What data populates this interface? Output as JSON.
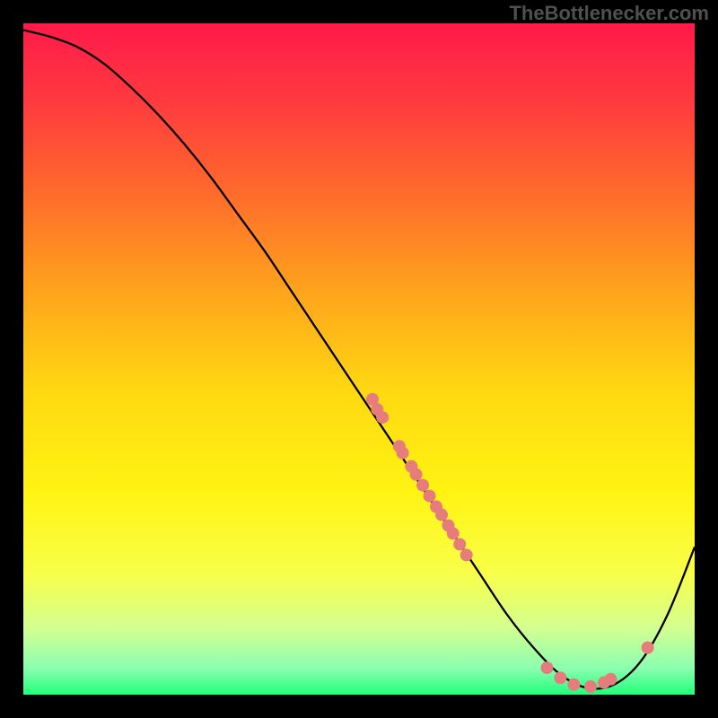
{
  "watermark": "TheBottlenecker.com",
  "chart_data": {
    "type": "line",
    "title": "",
    "xlabel": "",
    "ylabel": "",
    "xlim": [
      0,
      100
    ],
    "ylim": [
      0,
      100
    ],
    "background_gradient": {
      "stops": [
        {
          "offset": 0.0,
          "color": "#ff1a4a"
        },
        {
          "offset": 0.12,
          "color": "#ff3b3e"
        },
        {
          "offset": 0.25,
          "color": "#ff6a2c"
        },
        {
          "offset": 0.4,
          "color": "#ffa41c"
        },
        {
          "offset": 0.55,
          "color": "#ffd911"
        },
        {
          "offset": 0.7,
          "color": "#fff413"
        },
        {
          "offset": 0.82,
          "color": "#f8ff4a"
        },
        {
          "offset": 0.9,
          "color": "#d4ff90"
        },
        {
          "offset": 0.96,
          "color": "#8cffb0"
        },
        {
          "offset": 1.0,
          "color": "#20ff7a"
        }
      ]
    },
    "series": [
      {
        "name": "bottleneck-curve",
        "x": [
          0,
          4,
          8,
          12,
          16,
          20,
          24,
          28,
          32,
          36,
          40,
          44,
          48,
          52,
          56,
          60,
          64,
          68,
          72,
          76,
          80,
          84,
          88,
          92,
          96,
          100
        ],
        "y": [
          99,
          98,
          96.5,
          94,
          90.5,
          86.5,
          82,
          77,
          71.5,
          66,
          60,
          54,
          48,
          42,
          36,
          30,
          24,
          18,
          12,
          7,
          3,
          1,
          1.5,
          5,
          12,
          22
        ]
      }
    ],
    "scatter_points": {
      "name": "highlight-points",
      "color": "#e77c7c",
      "points": [
        {
          "x": 52.0,
          "y": 44.0
        },
        {
          "x": 52.7,
          "y": 42.5
        },
        {
          "x": 53.5,
          "y": 41.3
        },
        {
          "x": 56.0,
          "y": 37.0
        },
        {
          "x": 56.5,
          "y": 36.0
        },
        {
          "x": 57.8,
          "y": 34.0
        },
        {
          "x": 58.5,
          "y": 32.8
        },
        {
          "x": 59.5,
          "y": 31.2
        },
        {
          "x": 60.5,
          "y": 29.6
        },
        {
          "x": 61.5,
          "y": 28.0
        },
        {
          "x": 62.3,
          "y": 26.8
        },
        {
          "x": 63.3,
          "y": 25.2
        },
        {
          "x": 64.0,
          "y": 24.0
        },
        {
          "x": 65.0,
          "y": 22.4
        },
        {
          "x": 66.0,
          "y": 20.8
        },
        {
          "x": 78.0,
          "y": 4.0
        },
        {
          "x": 80.0,
          "y": 2.5
        },
        {
          "x": 82.0,
          "y": 1.5
        },
        {
          "x": 84.5,
          "y": 1.2
        },
        {
          "x": 86.5,
          "y": 1.8
        },
        {
          "x": 87.5,
          "y": 2.3
        },
        {
          "x": 93.0,
          "y": 7.0
        }
      ]
    }
  }
}
